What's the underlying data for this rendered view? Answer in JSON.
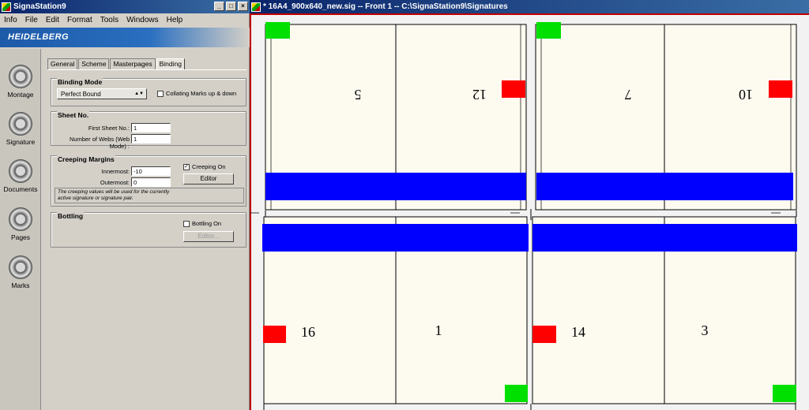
{
  "left_window": {
    "title": "SignaStation9",
    "buttons": [
      "_",
      "□",
      "×"
    ],
    "menu": [
      "Info",
      "File",
      "Edit",
      "Format",
      "Tools",
      "Windows",
      "Help"
    ],
    "brand": "HEIDELBERG",
    "nav": [
      {
        "label": "Montage",
        "icon": "montage-icon"
      },
      {
        "label": "Signature",
        "icon": "signature-icon"
      },
      {
        "label": "Documents",
        "icon": "documents-icon"
      },
      {
        "label": "Pages",
        "icon": "pages-icon"
      },
      {
        "label": "Marks",
        "icon": "marks-icon"
      }
    ],
    "tabs": [
      "General",
      "Scheme",
      "Masterpages",
      "Binding"
    ],
    "active_tab": "Binding",
    "binding_mode": {
      "title": "Binding Mode",
      "select_value": "Perfect Bound",
      "collating_label": "Collating Marks up & down",
      "collating_checked": false
    },
    "sheet_no": {
      "title": "Sheet No.",
      "first_label": "First Sheet No.:",
      "first_value": "1",
      "webs_label": "Number of Webs (Web Mode) :",
      "webs_value": "1"
    },
    "creeping": {
      "title": "Creeping Margins",
      "innermost_label": "Innermost:",
      "innermost_value": "-10",
      "outermost_label": "Outermost:",
      "outermost_value": "0",
      "creeping_on_label": "Creeping On",
      "creeping_on_checked": true,
      "check_mark": "✓",
      "editor_label": "Editor",
      "note_line1": "The creeping values will be used for the currently",
      "note_line2": "active signature or signature pair."
    },
    "bottling": {
      "title": "Bottling",
      "bottling_on_label": "Bottling On",
      "bottling_on_checked": false,
      "editor_label": "Editor..."
    }
  },
  "right_window": {
    "title": "* 16A4_900x640_new.sig  --  Front 1 -- C:\\SignaStation9\\Signatures",
    "pages_top": [
      "5",
      "12",
      "7",
      "10"
    ],
    "pages_bottom": [
      "16",
      "1",
      "14",
      "3"
    ],
    "colors": {
      "page_fill": "#fdfaf0",
      "blue_band": "#0000ff",
      "red_mark": "#ff0000",
      "green_mark": "#00e000",
      "frame": "#c00000"
    }
  }
}
